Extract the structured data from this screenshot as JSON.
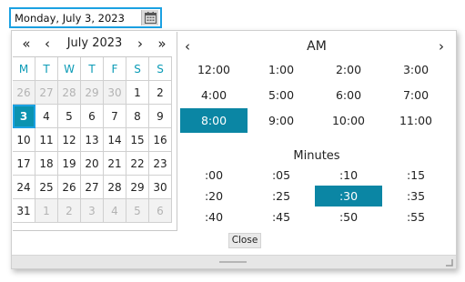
{
  "date_input": {
    "value": "Monday, July 3, 2023",
    "button_icon": "calendar-icon"
  },
  "calendar": {
    "prev_year": "«",
    "prev_month": "‹",
    "month_title": "July 2023",
    "next_month": "›",
    "next_year": "»",
    "weekdays": [
      "M",
      "T",
      "W",
      "T",
      "F",
      "S",
      "S"
    ],
    "weeks": [
      [
        {
          "d": "26",
          "other": true
        },
        {
          "d": "27",
          "other": true
        },
        {
          "d": "28",
          "other": true
        },
        {
          "d": "29",
          "other": true
        },
        {
          "d": "30",
          "other": true
        },
        {
          "d": "1"
        },
        {
          "d": "2"
        }
      ],
      [
        {
          "d": "3",
          "selected": true
        },
        {
          "d": "4"
        },
        {
          "d": "5"
        },
        {
          "d": "6"
        },
        {
          "d": "7"
        },
        {
          "d": "8"
        },
        {
          "d": "9"
        }
      ],
      [
        {
          "d": "10"
        },
        {
          "d": "11"
        },
        {
          "d": "12"
        },
        {
          "d": "13"
        },
        {
          "d": "14"
        },
        {
          "d": "15"
        },
        {
          "d": "16"
        }
      ],
      [
        {
          "d": "17"
        },
        {
          "d": "18"
        },
        {
          "d": "19"
        },
        {
          "d": "20"
        },
        {
          "d": "21"
        },
        {
          "d": "22"
        },
        {
          "d": "23"
        }
      ],
      [
        {
          "d": "24"
        },
        {
          "d": "25"
        },
        {
          "d": "26"
        },
        {
          "d": "27"
        },
        {
          "d": "28"
        },
        {
          "d": "29"
        },
        {
          "d": "30"
        }
      ],
      [
        {
          "d": "31"
        },
        {
          "d": "1",
          "other": true
        },
        {
          "d": "2",
          "other": true
        },
        {
          "d": "3",
          "other": true
        },
        {
          "d": "4",
          "other": true
        },
        {
          "d": "5",
          "other": true
        },
        {
          "d": "6",
          "other": true
        }
      ]
    ]
  },
  "time": {
    "prev": "‹",
    "next": "›",
    "period": "AM",
    "hours": [
      "12:00",
      "1:00",
      "2:00",
      "3:00",
      "4:00",
      "5:00",
      "6:00",
      "7:00",
      "8:00",
      "9:00",
      "10:00",
      "11:00"
    ],
    "selected_hour": "8:00",
    "minutes_title": "Minutes",
    "minutes": [
      ":00",
      ":05",
      ":10",
      ":15",
      ":20",
      ":25",
      ":30",
      ":35",
      ":40",
      ":45",
      ":50",
      ":55"
    ],
    "selected_minute": ":30",
    "close_label": "Close"
  },
  "colors": {
    "accent": "#0b93b0",
    "focus_border": "#1ba1e2",
    "weekday_text": "#0b9bb6",
    "other_month_bg": "#f2f2f2"
  }
}
